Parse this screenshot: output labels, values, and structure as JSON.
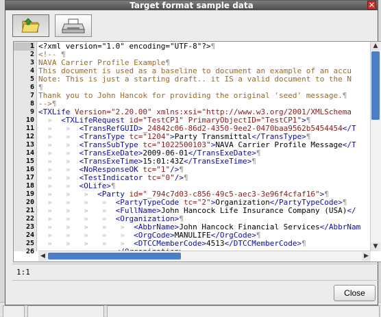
{
  "window": {
    "title": "Target format sample data",
    "close_glyph": "✕"
  },
  "toolbar": {
    "open_icon": "open-folder-icon",
    "print_icon": "printer-icon"
  },
  "editor": {
    "lines": [
      {
        "n": "1",
        "parts": [
          [
            "pi",
            "<?xml version=\"1.0\" encoding=\"UTF-8\"?>"
          ],
          [
            "pil",
            "¶"
          ]
        ]
      },
      {
        "n": "2",
        "parts": [
          [
            "cmt",
            "<!-- "
          ],
          [
            "pil",
            "¶"
          ]
        ]
      },
      {
        "n": "3",
        "parts": [
          [
            "cmt",
            "NAVA Carrier Profile Example"
          ],
          [
            "pil",
            "¶"
          ]
        ]
      },
      {
        "n": "4",
        "parts": [
          [
            "cmt",
            "This document is used as a baseline to document an example of an accu"
          ]
        ]
      },
      {
        "n": "5",
        "parts": [
          [
            "cmt",
            "Note: This is just a starting draft.. it IS a valid document to the N"
          ]
        ]
      },
      {
        "n": "6",
        "parts": [
          [
            "pil",
            "¶"
          ]
        ]
      },
      {
        "n": "7",
        "parts": [
          [
            "cmt",
            "Thank you to John Hancok for providing the original 'seed' message."
          ],
          [
            "pil",
            "¶"
          ]
        ]
      },
      {
        "n": "8",
        "parts": [
          [
            "cmt",
            "-->"
          ],
          [
            "pil",
            "¶"
          ]
        ]
      },
      {
        "n": "9",
        "parts": [
          [
            "tag",
            "<TXLife "
          ],
          [
            "attr",
            "Version="
          ],
          [
            "val",
            "\"2.20.00\""
          ],
          [
            "attr",
            " xmlns:xsi="
          ],
          [
            "val",
            "\"http://www.w3.org/2001/XMLSchema"
          ]
        ]
      },
      {
        "n": "10",
        "parts": [
          [
            "ws",
            "  »  "
          ],
          [
            "tag",
            "<TXLifeRequest "
          ],
          [
            "attr",
            "id="
          ],
          [
            "val",
            "\"TestCP1\""
          ],
          [
            "attr",
            " PrimaryObjectID="
          ],
          [
            "val",
            "\"TestCP1\""
          ],
          [
            "tag",
            ">"
          ],
          [
            "pil",
            "¶"
          ]
        ]
      },
      {
        "n": "11",
        "parts": [
          [
            "ws",
            "  »   »  "
          ],
          [
            "tag",
            "<TransRefGUID>"
          ],
          [
            "val",
            "_24842c06-86d2-4350-9ee2-0470baa9562b5454454"
          ],
          [
            "tag",
            "</T"
          ]
        ]
      },
      {
        "n": "12",
        "parts": [
          [
            "ws",
            "  »   »  "
          ],
          [
            "tag",
            "<TransType "
          ],
          [
            "attr",
            "tc="
          ],
          [
            "val",
            "\"1204\""
          ],
          [
            "tag",
            ">"
          ],
          [
            "text",
            "Party Transmittal"
          ],
          [
            "tag",
            "</TransType>"
          ],
          [
            "pil",
            "¶"
          ]
        ]
      },
      {
        "n": "13",
        "parts": [
          [
            "ws",
            "  »   »  "
          ],
          [
            "tag",
            "<TransSubType "
          ],
          [
            "attr",
            "tc="
          ],
          [
            "val",
            "\"1022500103\""
          ],
          [
            "tag",
            ">"
          ],
          [
            "text",
            "NAVA Carrier Profile Message"
          ],
          [
            "tag",
            "</T"
          ]
        ]
      },
      {
        "n": "14",
        "parts": [
          [
            "ws",
            "  »   »  "
          ],
          [
            "tag",
            "<TransExeDate>"
          ],
          [
            "text",
            "2009-06-01"
          ],
          [
            "tag",
            "</TransExeDate>"
          ],
          [
            "pil",
            "¶"
          ]
        ]
      },
      {
        "n": "15",
        "parts": [
          [
            "ws",
            "  »   »  "
          ],
          [
            "tag",
            "<TransExeTime>"
          ],
          [
            "text",
            "15:01:43Z"
          ],
          [
            "tag",
            "</TransExeTime>"
          ],
          [
            "pil",
            "¶"
          ]
        ]
      },
      {
        "n": "16",
        "parts": [
          [
            "ws",
            "  »   »  "
          ],
          [
            "tag",
            "<NoResponseOK "
          ],
          [
            "attr",
            "tc="
          ],
          [
            "val",
            "\"1\""
          ],
          [
            "tag",
            "/>"
          ],
          [
            "pil",
            "¶"
          ]
        ]
      },
      {
        "n": "17",
        "parts": [
          [
            "ws",
            "  »   »  "
          ],
          [
            "tag",
            "<TestIndicator "
          ],
          [
            "attr",
            "tc="
          ],
          [
            "val",
            "\"0\""
          ],
          [
            "tag",
            "/>"
          ],
          [
            "pil",
            "¶"
          ]
        ]
      },
      {
        "n": "18",
        "parts": [
          [
            "ws",
            "  »   »  "
          ],
          [
            "tag",
            "<OLife>"
          ],
          [
            "pil",
            "¶"
          ]
        ]
      },
      {
        "n": "19",
        "parts": [
          [
            "ws",
            "  »   »   »  "
          ],
          [
            "tag",
            "<Party "
          ],
          [
            "attr",
            "id="
          ],
          [
            "val",
            "\"_794c7d03-c856-49c5-aec3-3e96f4cfaf16\""
          ],
          [
            "tag",
            ">"
          ],
          [
            "pil",
            "¶"
          ]
        ]
      },
      {
        "n": "20",
        "parts": [
          [
            "ws",
            "  »   »   »   »  "
          ],
          [
            "tag",
            "<PartyTypeCode "
          ],
          [
            "attr",
            "tc="
          ],
          [
            "val",
            "\"2\""
          ],
          [
            "tag",
            ">"
          ],
          [
            "text",
            "Organization"
          ],
          [
            "tag",
            "</PartyTypeCode>"
          ],
          [
            "pil",
            "¶"
          ]
        ]
      },
      {
        "n": "21",
        "parts": [
          [
            "ws",
            "  »   »   »   »  "
          ],
          [
            "tag",
            "<FullName>"
          ],
          [
            "text",
            "John Hancock Life Insurance Company (USA)"
          ],
          [
            "tag",
            "</"
          ]
        ]
      },
      {
        "n": "22",
        "parts": [
          [
            "ws",
            "  »   »   »   »  "
          ],
          [
            "tag",
            "<Organization>"
          ],
          [
            "pil",
            "¶"
          ]
        ]
      },
      {
        "n": "23",
        "parts": [
          [
            "ws",
            "  »   »   »   »   »  "
          ],
          [
            "tag",
            "<AbbrName>"
          ],
          [
            "text",
            "John Hancock Financial Services"
          ],
          [
            "tag",
            "</AbbrNam"
          ]
        ]
      },
      {
        "n": "24",
        "parts": [
          [
            "ws",
            "  »   »   »   »   »  "
          ],
          [
            "tag",
            "<OrgCode>"
          ],
          [
            "text",
            "MANULIFE"
          ],
          [
            "tag",
            "</OrgCode>"
          ],
          [
            "pil",
            "¶"
          ]
        ]
      },
      {
        "n": "25",
        "parts": [
          [
            "ws",
            "  »   »   »   »   »  "
          ],
          [
            "tag",
            "<DTCCMemberCode>"
          ],
          [
            "text",
            "4513"
          ],
          [
            "tag",
            "</DTCCMemberCode>"
          ],
          [
            "pil",
            "¶"
          ]
        ]
      },
      {
        "n": "26",
        "parts": [
          [
            "ws",
            "  »   »   »   »  "
          ],
          [
            "tag",
            "</Organization>"
          ]
        ]
      }
    ]
  },
  "status": {
    "cursor_position": "1:1"
  },
  "buttons": {
    "close_label": "Close"
  }
}
